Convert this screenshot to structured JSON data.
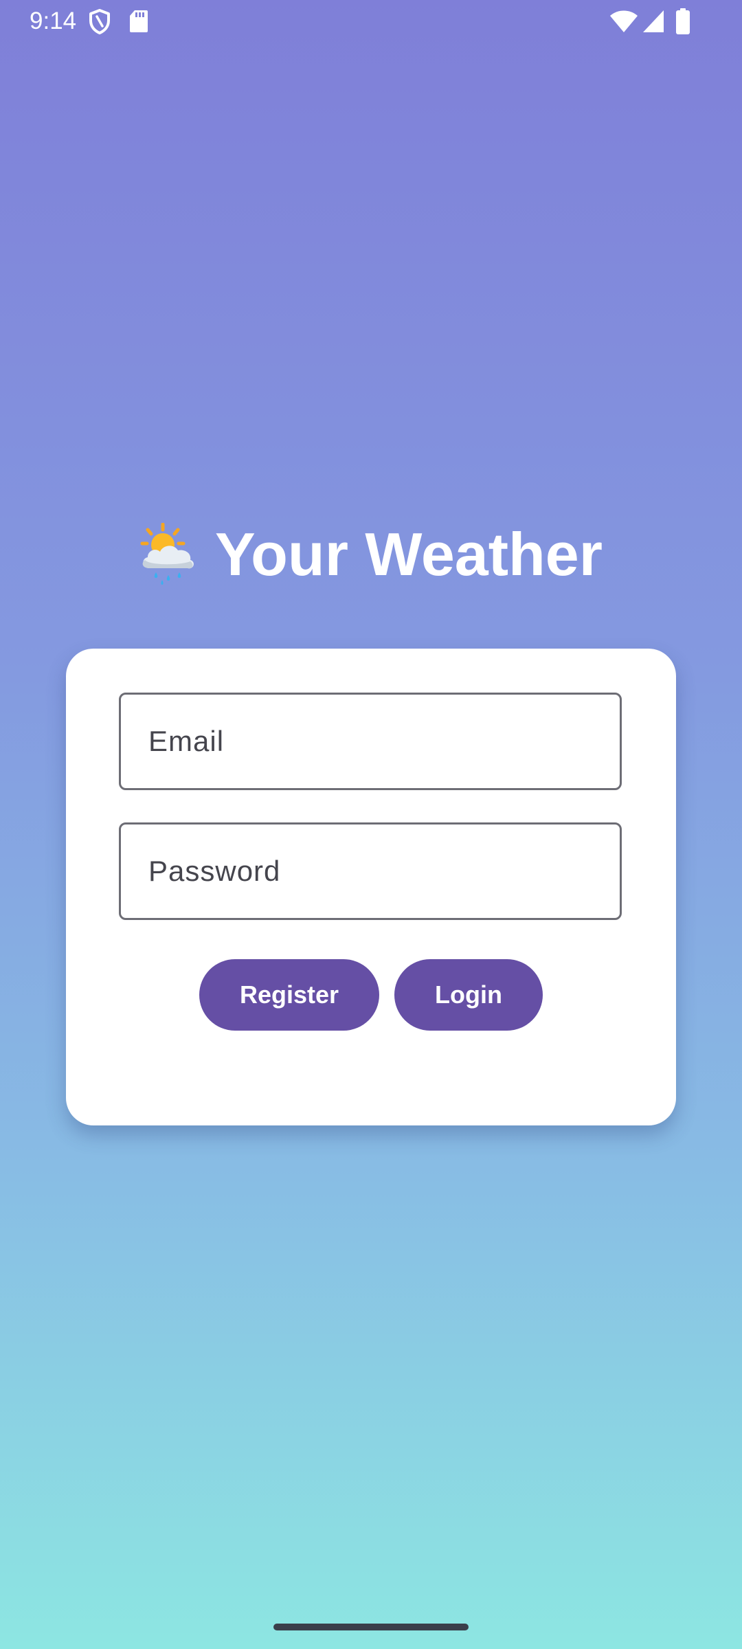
{
  "status_bar": {
    "time": "9:14",
    "icons": [
      "shield-icon",
      "sd-card-icon",
      "wifi-icon",
      "cell-signal-icon",
      "battery-icon"
    ]
  },
  "header": {
    "emoji_icon": "sun-behind-rain-cloud-icon",
    "title": "Your Weather"
  },
  "login_form": {
    "email_placeholder": "Email",
    "password_placeholder": "Password",
    "register_label": "Register",
    "login_label": "Login"
  },
  "colors": {
    "gradient_top": "#7f7fd8",
    "gradient_bottom": "#8de6e2",
    "button": "#654fa5",
    "card": "#ffffff"
  }
}
